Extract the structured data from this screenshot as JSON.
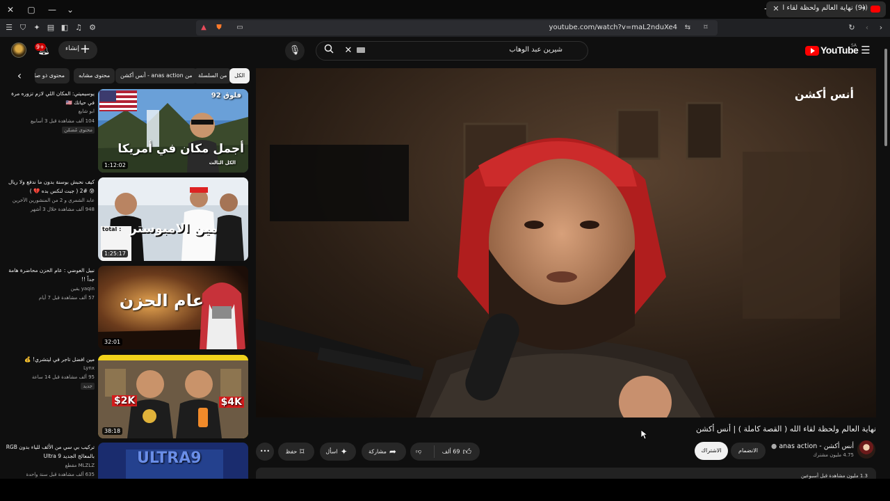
{
  "browser": {
    "tab_title": "(9) نهاية العالم ولحظة لقاء الله (",
    "url": "youtube.com/watch?v=maL2nduXe4"
  },
  "header": {
    "create_label": "إنشاء",
    "notification_count": "9+",
    "search_query": "شيرين عبد الوهاب",
    "logo_text": "YouTube",
    "logo_region": "SA"
  },
  "chips": {
    "all": "الكل",
    "series": "من السلسلة",
    "channel": "من anas action - أنس أكشن",
    "similar": "محتوى مشابه",
    "related": "محتوى ذو صلة"
  },
  "suggestions": [
    {
      "title": "يوسيميتي: المكان اللي لازم تزوره مرة في حياتك 🇺🇸",
      "channel": "ابو شايع",
      "meta": "104 ألف مشاهدة قبل 3 أسابيع",
      "badge": "محتوى مُضمّن",
      "duration": "1:12:02",
      "thumb_line1": "أجمل مكان في أمريكا",
      "thumb_line2": "فلوق 92",
      "thumb_line3": "الكل الثالث"
    },
    {
      "title": "كيف نحبش بوسنة بدون ما ندفع ولا ريال 😰 #2 ( جبت لنكس بده 💔 )",
      "channel": "عابد الشمري و 2 من المنشورين الآخرين",
      "meta": "948 ألف مشاهدة خلال 3 أشهر",
      "duration": "1:25:17",
      "thumb_line1": "مين الامبوستر",
      "thumb_line2": "total :"
    },
    {
      "title": "نبيل العوضي : عام الحزن محاضرة هامة جداً !!",
      "channel": "yaqin يقين",
      "meta": "57 ألف مشاهدة قبل 7 أيام",
      "duration": "32:01",
      "thumb_line1": "عام الحزن"
    },
    {
      "title": "مين افضل تاجر في ليتشري! 💰",
      "channel": "Lynx",
      "meta": "95 ألف مشاهدة قبل 14 ساعة",
      "badge": "جديد",
      "duration": "38:18",
      "thumb_line1": "$2K",
      "thumb_line2": "$4K"
    },
    {
      "title": "تركيب بي سي من الألف للياء بدون RGB بالمعالج الجديد Ultra 9",
      "channel": "MLZLZ مقطع",
      "meta": "635 ألف مشاهدة قبل سنة واحدة",
      "thumb_line1": "ULTRA9"
    }
  ],
  "player": {
    "brand": "أنس أكشن"
  },
  "video": {
    "title": "نهاية العالم ولحظة لقاء الله ( القصة كاملة ) | أنس أكشن",
    "channel_name": "أنس أكشن - anas action",
    "subscribers": "4.75 مليون مشترك",
    "join_label": "الانضمام",
    "subscribe_label": "الاشتراك",
    "likes": "69 ألف",
    "share_label": "مشاركة",
    "ask_label": "اسأل",
    "save_label": "حفظ",
    "description_meta": "1.3 مليون مشاهدة قبل أسبوعين"
  },
  "colors": {
    "background": "#0f0f0f",
    "accent_red": "#ff0000",
    "chip_bg": "#272727"
  }
}
